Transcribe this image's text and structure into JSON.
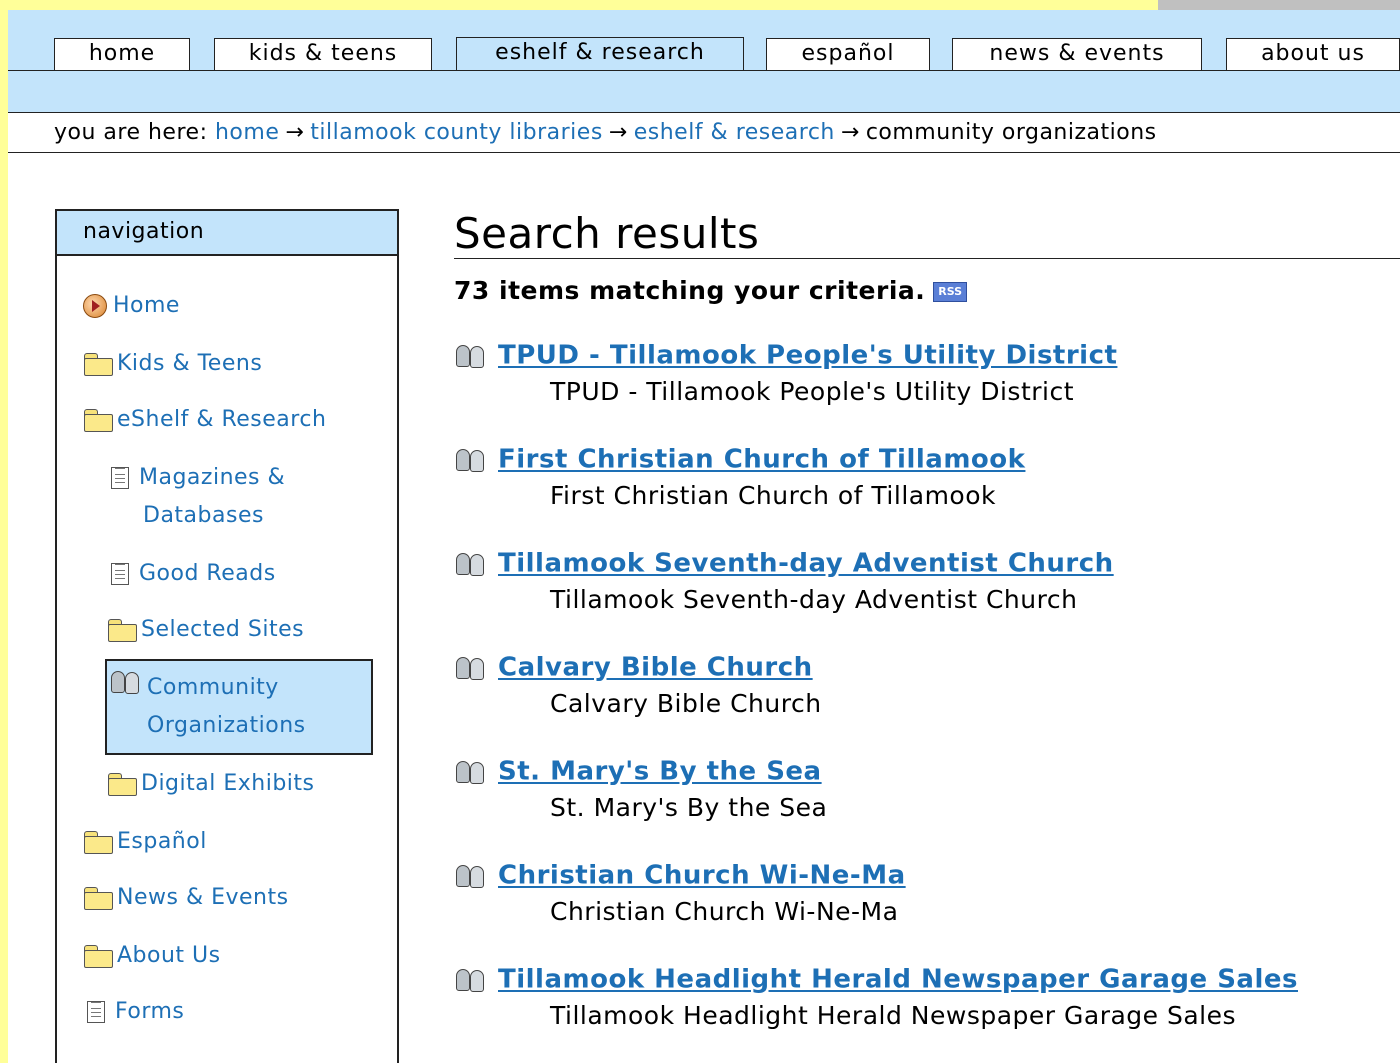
{
  "tabs": [
    {
      "label": "home",
      "selected": false
    },
    {
      "label": "kids & teens",
      "selected": false
    },
    {
      "label": "eshelf & research",
      "selected": true
    },
    {
      "label": "español",
      "selected": false
    },
    {
      "label": "news & events",
      "selected": false
    },
    {
      "label": "about us",
      "selected": false
    }
  ],
  "breadcrumb": {
    "prefix": "you are here:",
    "links": [
      "home",
      "tillamook county libraries",
      "eshelf & research"
    ],
    "current": "community organizations",
    "separator": "→"
  },
  "navigation": {
    "header": "navigation",
    "items": [
      {
        "label": "Home",
        "icon": "home-icon"
      },
      {
        "label": "Kids & Teens",
        "icon": "folder-icon"
      },
      {
        "label": "eShelf & Research",
        "icon": "folder-icon"
      },
      {
        "label": "Magazines &",
        "label2": "Databases",
        "icon": "document-icon"
      },
      {
        "label": "Good Reads",
        "icon": "document-icon"
      },
      {
        "label": "Selected Sites",
        "icon": "folder-icon"
      },
      {
        "label": "Community",
        "label2": "Organizations",
        "icon": "people-icon",
        "current": true
      },
      {
        "label": "Digital Exhibits",
        "icon": "folder-icon"
      },
      {
        "label": "Español",
        "icon": "folder-icon"
      },
      {
        "label": "News & Events",
        "icon": "folder-icon"
      },
      {
        "label": "About Us",
        "icon": "folder-icon"
      },
      {
        "label": "Forms",
        "icon": "document-icon"
      }
    ]
  },
  "main": {
    "title": "Search results",
    "count_text": "73 items matching your criteria.",
    "rss_label": "RSS",
    "results": [
      {
        "title": "TPUD - Tillamook People's Utility District",
        "description": "TPUD - Tillamook People's Utility District"
      },
      {
        "title": "First Christian Church of Tillamook",
        "description": "First Christian Church of Tillamook"
      },
      {
        "title": "Tillamook Seventh-day Adventist Church",
        "description": "Tillamook Seventh-day Adventist Church"
      },
      {
        "title": "Calvary Bible Church",
        "description": "Calvary Bible Church"
      },
      {
        "title": "St. Mary's By the Sea",
        "description": "St. Mary's By the Sea"
      },
      {
        "title": "Christian Church Wi-Ne-Ma",
        "description": "Christian Church Wi-Ne-Ma"
      },
      {
        "title": "Tillamook Headlight Herald Newspaper Garage Sales",
        "description": "Tillamook Headlight Herald Newspaper Garage Sales"
      }
    ]
  },
  "colors": {
    "accent_blue": "#c3e4fb",
    "link": "#1d6fb5",
    "page_margin": "#ffff99"
  }
}
